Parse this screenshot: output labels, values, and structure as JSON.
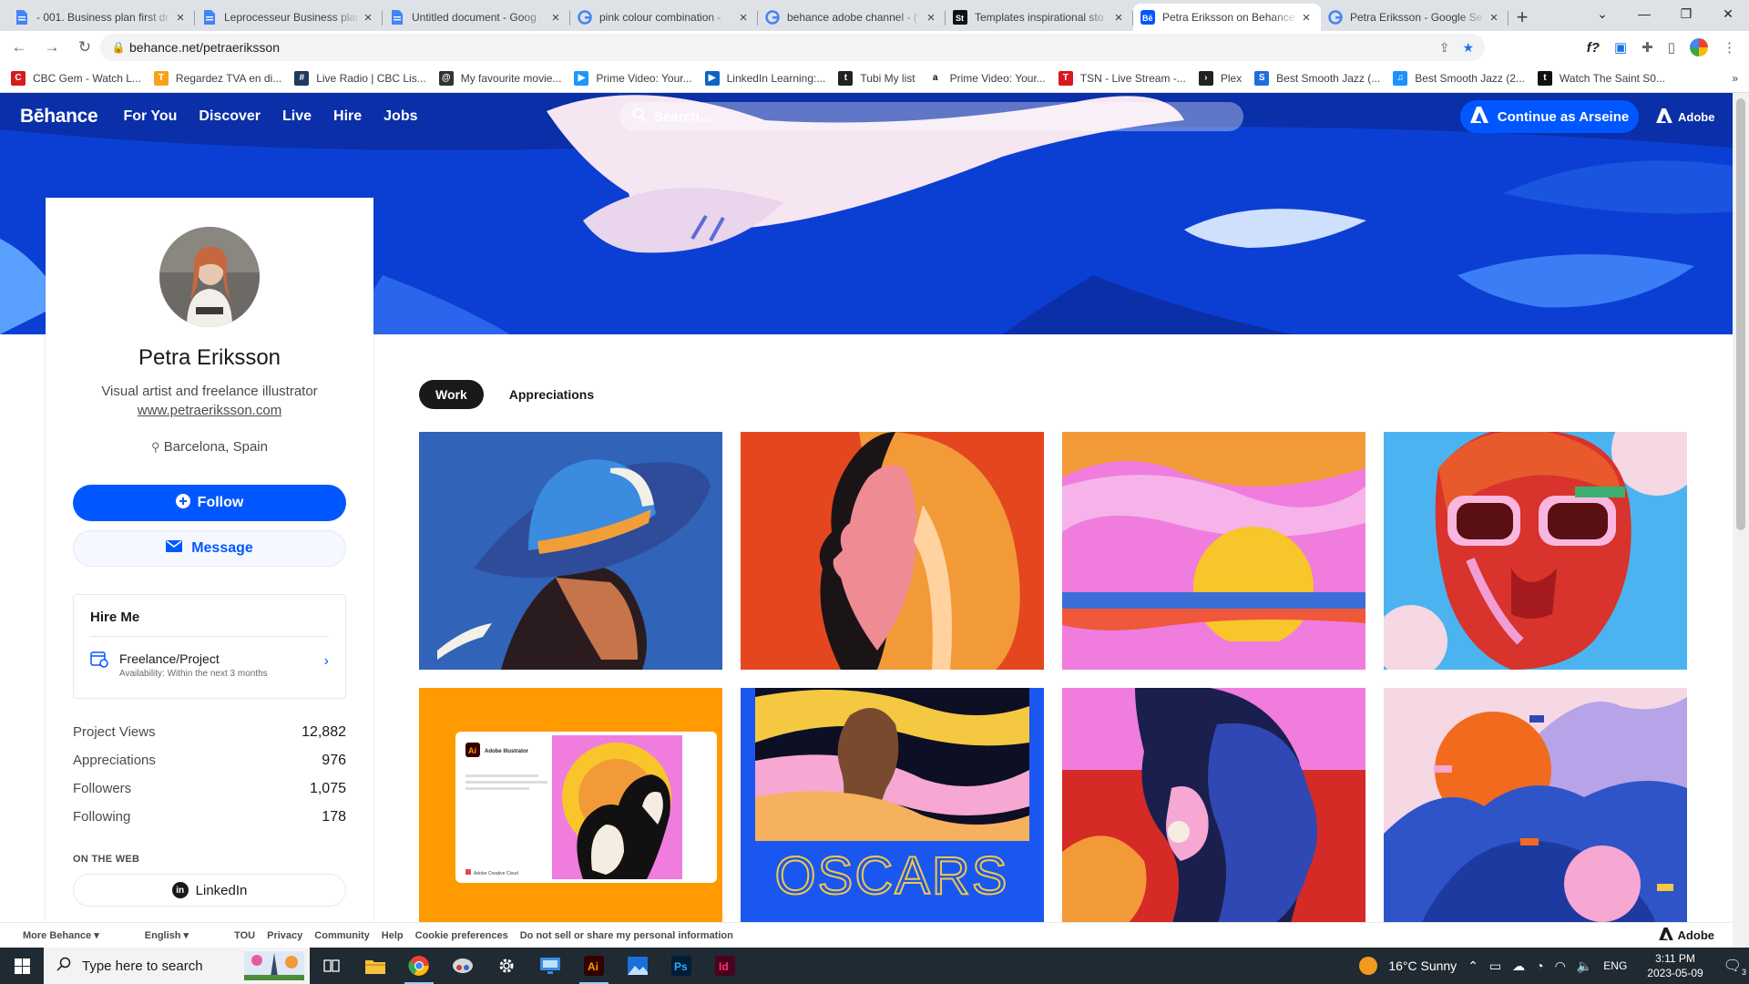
{
  "browser": {
    "tabs": [
      {
        "title": "- 001. Business plan first dr",
        "icon": "google-docs",
        "color": "#4285f4"
      },
      {
        "title": "Leprocesseur Business plan",
        "icon": "google-docs",
        "color": "#4285f4"
      },
      {
        "title": "Untitled document - Goog",
        "icon": "google-docs",
        "color": "#4285f4"
      },
      {
        "title": "pink colour combination -",
        "icon": "google",
        "color": "#4285f4"
      },
      {
        "title": "behance adobe channel - (",
        "icon": "google",
        "color": "#4285f4"
      },
      {
        "title": "Templates inspirational sto",
        "icon": "storyblocks",
        "color": "#111111"
      },
      {
        "title": "Petra Eriksson on Behance",
        "icon": "behance",
        "color": "#0057ff",
        "active": true
      },
      {
        "title": "Petra Eriksson - Google Se",
        "icon": "google",
        "color": "#4285f4"
      }
    ],
    "url": "behance.net/petraeriksson",
    "bookmarks": [
      {
        "label": "CBC Gem - Watch L...",
        "color": "#d71920",
        "glyph": "C"
      },
      {
        "label": "Regardez TVA en di...",
        "color": "#f7a21b",
        "glyph": "T"
      },
      {
        "label": "Live Radio | CBC Lis...",
        "color": "#1f3a5f",
        "glyph": "#"
      },
      {
        "label": "My favourite movie...",
        "color": "#333333",
        "glyph": "@"
      },
      {
        "label": "Prime Video: Your...",
        "color": "#1a98ff",
        "glyph": "▶"
      },
      {
        "label": "LinkedIn Learning:...",
        "color": "#0a66c2",
        "glyph": "▶"
      },
      {
        "label": "Tubi My list",
        "color": "#222222",
        "glyph": "t"
      },
      {
        "label": "Prime Video: Your...",
        "color": "#ffffff",
        "glyph": "a"
      },
      {
        "label": "TSN - Live Stream -...",
        "color": "#d71920",
        "glyph": "T"
      },
      {
        "label": "Plex",
        "color": "#222222",
        "glyph": "›"
      },
      {
        "label": "Best Smooth Jazz (...",
        "color": "#1e6fd9",
        "glyph": "S"
      },
      {
        "label": "Best Smooth Jazz (2...",
        "color": "#1e90ff",
        "glyph": "♫"
      },
      {
        "label": "Watch The Saint S0...",
        "color": "#111111",
        "glyph": "t"
      }
    ]
  },
  "behance": {
    "nav": {
      "logo": "Bēhance",
      "links": [
        "For You",
        "Discover",
        "Live",
        "Hire",
        "Jobs"
      ],
      "search_placeholder": "Search...",
      "cta": "Continue as Arseine",
      "brand": "Adobe"
    },
    "profile": {
      "name": "Petra Eriksson",
      "tagline": "Visual artist and freelance illustrator",
      "website": "www.petraeriksson.com",
      "location": "Barcelona, Spain",
      "follow_label": "Follow",
      "message_label": "Message",
      "hire": {
        "title": "Hire Me",
        "type": "Freelance/Project",
        "availability": "Availability: Within the next 3 months"
      },
      "stats": [
        {
          "label": "Project Views",
          "value": "12,882"
        },
        {
          "label": "Appreciations",
          "value": "976"
        },
        {
          "label": "Followers",
          "value": "1,075"
        },
        {
          "label": "Following",
          "value": "178"
        }
      ],
      "on_the_web_label": "ON THE WEB",
      "linkedin_label": "LinkedIn"
    },
    "tabs": [
      {
        "label": "Work",
        "active": true
      },
      {
        "label": "Appreciations",
        "active": false
      }
    ],
    "projects": [
      {
        "art": "hat-woman"
      },
      {
        "art": "profile-woman"
      },
      {
        "art": "sunset"
      },
      {
        "art": "sunglasses-face"
      },
      {
        "art": "adobe-illustrator-splash",
        "overlay": {
          "brand": "Adobe Illustrator",
          "footer": "Adobe Creative Cloud"
        }
      },
      {
        "art": "oscars-poster",
        "overlay": {
          "title": "OSCARS"
        }
      },
      {
        "art": "blue-profile"
      },
      {
        "art": "mountains"
      }
    ],
    "footer": {
      "links": [
        "More Behance ▾",
        "English ▾",
        "TOU",
        "Privacy",
        "Community",
        "Help",
        "Cookie preferences",
        "Do not sell or share my personal information"
      ],
      "brand": "Adobe"
    }
  },
  "taskbar": {
    "search_placeholder": "Type here to search",
    "weather": "16°C  Sunny",
    "lang": "ENG",
    "time": "3:11 PM",
    "date": "2023-05-09",
    "notification_count": "3"
  }
}
